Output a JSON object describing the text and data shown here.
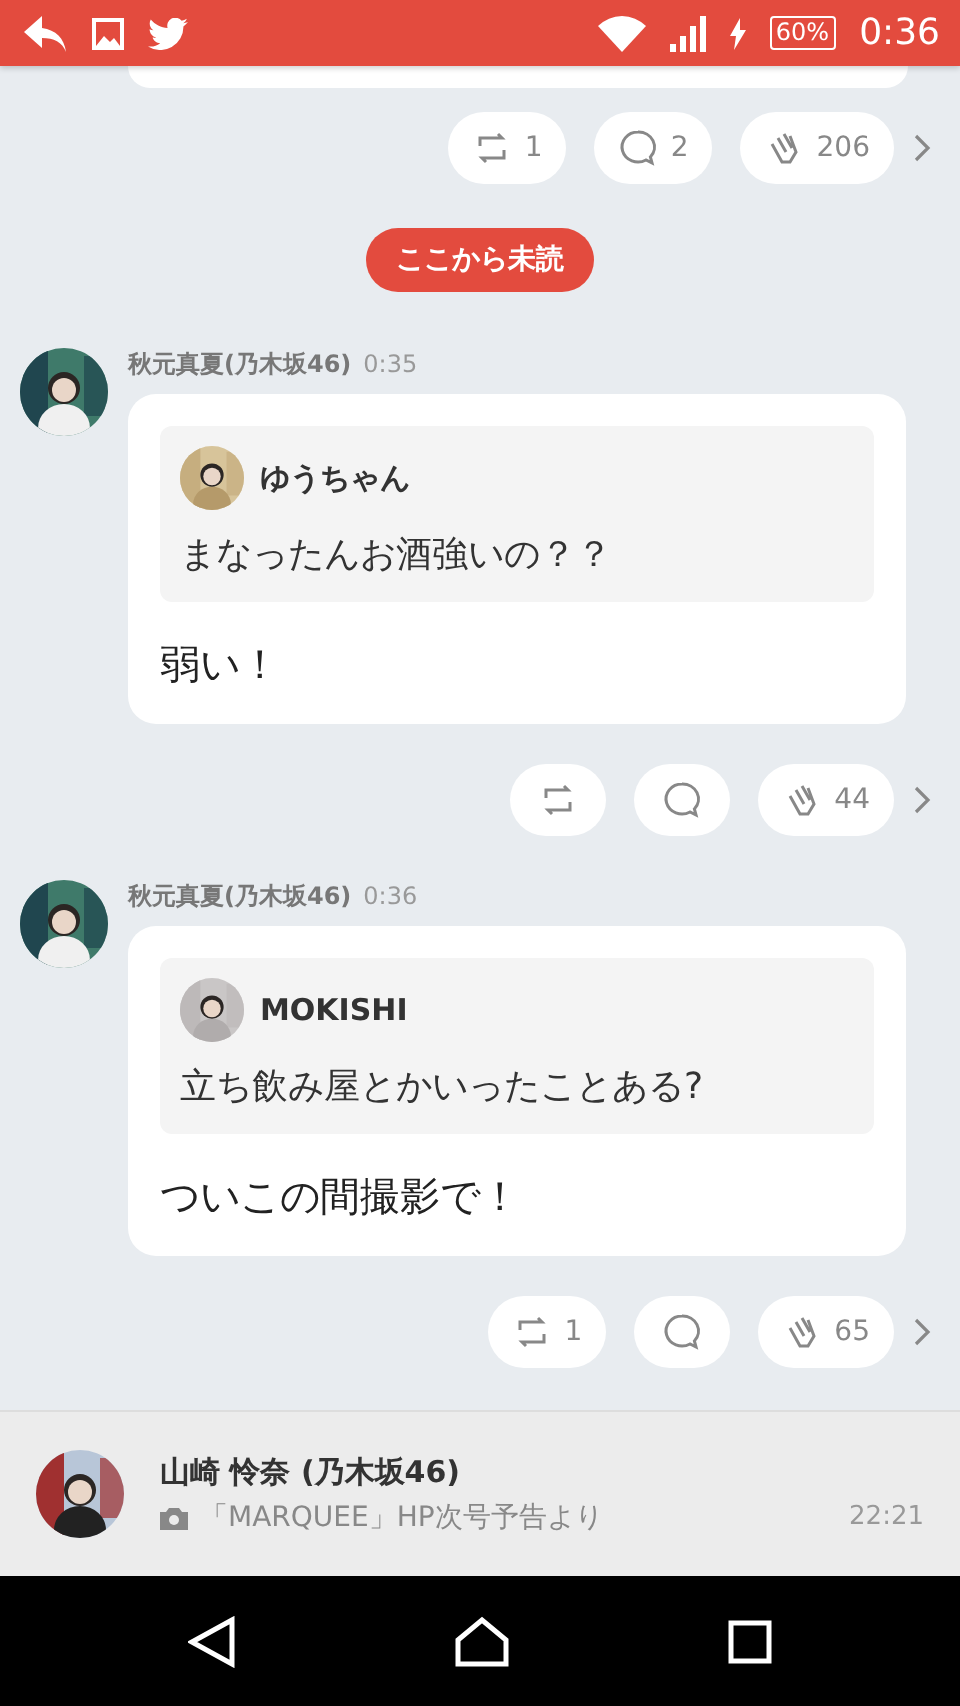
{
  "status_bar": {
    "battery": "60%",
    "time": "0:36"
  },
  "top_actions": {
    "repost": "1",
    "comment": "2",
    "clap": "206"
  },
  "unread_divider": "ここから未読",
  "messages": [
    {
      "author": "秋元真夏(乃木坂46)",
      "time": "0:35",
      "quote": {
        "name": "ゆうちゃん",
        "text": "まなったんお酒強いの？？"
      },
      "text": "弱い！",
      "actions": {
        "clap": "44"
      }
    },
    {
      "author": "秋元真夏(乃木坂46)",
      "time": "0:36",
      "quote": {
        "name": "MOKISHI",
        "text": "立ち飲み屋とかいったことある?"
      },
      "text": "ついこの間撮影で！",
      "actions": {
        "repost": "1",
        "clap": "65"
      }
    }
  ],
  "notification": {
    "name": "山崎 怜奈 (乃木坂46)",
    "text": "「MARQUEE」HP次号予告より",
    "time": "22:21"
  }
}
